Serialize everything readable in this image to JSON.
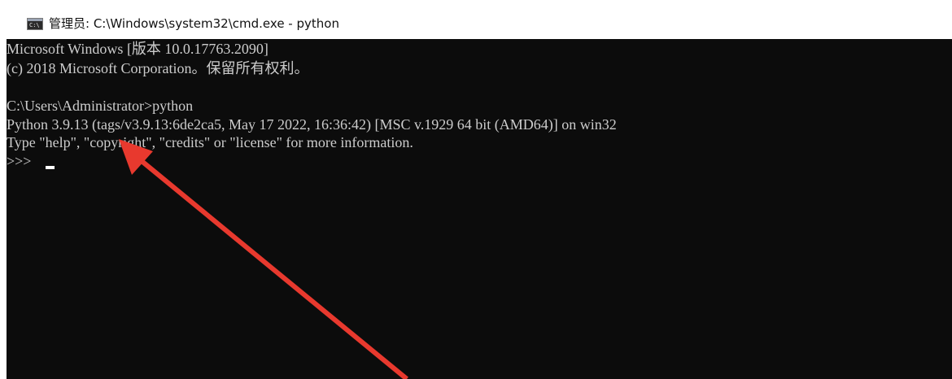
{
  "window": {
    "title": "管理员: C:\\Windows\\system32\\cmd.exe - python",
    "icon": "cmd-console-icon",
    "icon_label": "C:\\"
  },
  "console": {
    "lines": [
      "Microsoft Windows [版本 10.0.17763.2090]",
      "(c) 2018 Microsoft Corporation。保留所有权利。",
      "",
      "C:\\Users\\Administrator>python",
      "Python 3.9.13 (tags/v3.9.13:6de2ca5, May 17 2022, 16:36:42) [MSC v.1929 64 bit (AMD64)] on win32",
      "Type \"help\", \"copyright\", \"credits\" or \"license\" for more information.",
      ">>> "
    ],
    "colors": {
      "background": "#0c0c0c",
      "text": "#cccccc",
      "cursor": "#ffffff"
    }
  },
  "annotation": {
    "type": "arrow",
    "color": "#e8392e"
  }
}
